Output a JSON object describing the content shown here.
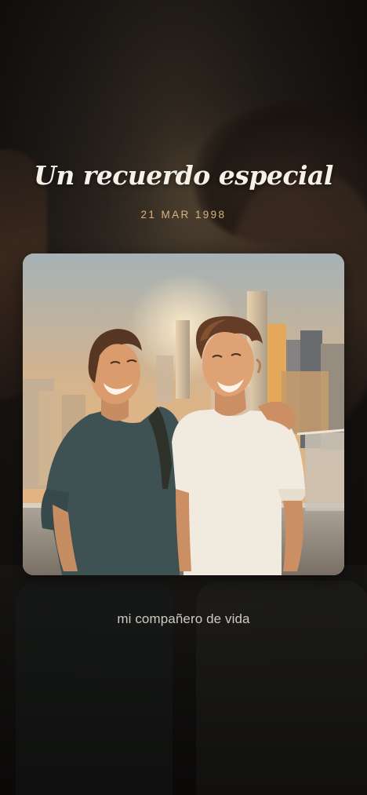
{
  "card": {
    "title": "Un recuerdo especial",
    "date": "21 MAR 1998",
    "caption": "mi compañero de vida"
  },
  "photo": {
    "subject": "two-friends-laughing-photo",
    "sky_top": "#9fb2bd",
    "sky_bottom": "#e9b67b",
    "shirt_left": "#2f4a52",
    "shirt_right": "#f1efe9",
    "accent_text": "#d8b384"
  }
}
